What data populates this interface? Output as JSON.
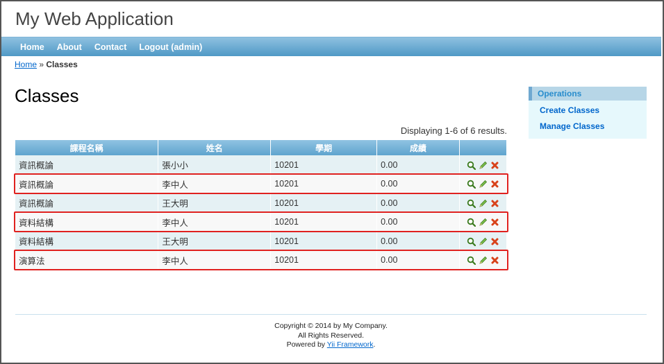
{
  "app": {
    "title": "My Web Application"
  },
  "mainmenu": {
    "items": [
      "Home",
      "About",
      "Contact",
      "Logout (admin)"
    ]
  },
  "breadcrumb": {
    "home": "Home",
    "separator": "»",
    "current": "Classes"
  },
  "page": {
    "title": "Classes"
  },
  "grid": {
    "summary": "Displaying 1-6 of 6 results.",
    "headers": [
      "課程名稱",
      "姓名",
      "學期",
      "成績",
      ""
    ],
    "rows": [
      {
        "course": "資訊概論",
        "name": "張小小",
        "term": "10201",
        "score": "0.00",
        "highlighted": false
      },
      {
        "course": "資訊概論",
        "name": "李中人",
        "term": "10201",
        "score": "0.00",
        "highlighted": true
      },
      {
        "course": "資訊概論",
        "name": "王大明",
        "term": "10201",
        "score": "0.00",
        "highlighted": false
      },
      {
        "course": "資料結構",
        "name": "李中人",
        "term": "10201",
        "score": "0.00",
        "highlighted": true
      },
      {
        "course": "資料結構",
        "name": "王大明",
        "term": "10201",
        "score": "0.00",
        "highlighted": false
      },
      {
        "course": "演算法",
        "name": "李中人",
        "term": "10201",
        "score": "0.00",
        "highlighted": true
      }
    ],
    "action_icons": [
      "view-icon",
      "update-icon",
      "delete-icon"
    ]
  },
  "sidebar": {
    "title": "Operations",
    "items": [
      "Create Classes",
      "Manage Classes"
    ]
  },
  "footer": {
    "copyright": "Copyright © 2014 by My Company.",
    "rights": "All Rights Reserved.",
    "powered_prefix": "Powered by ",
    "powered_link": "Yii Framework",
    "powered_suffix": "."
  },
  "colors": {
    "accent": "#5fa4ce",
    "highlight_border": "#e0211f",
    "link": "#0066cc"
  }
}
